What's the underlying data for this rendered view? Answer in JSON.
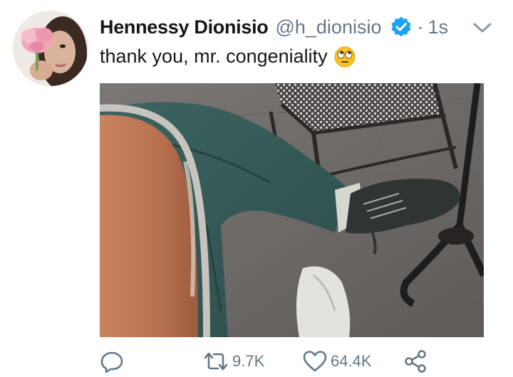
{
  "tweet": {
    "display_name": "Hennessy Dionisio",
    "handle": "@h_dionisio",
    "separator": "·",
    "timestamp": "1s",
    "text": "thank you, mr. congeniality"
  },
  "actions": {
    "retweet_count": "9.7K",
    "like_count": "64.4K"
  },
  "icons": {
    "verified": "verified-badge-icon",
    "more": "chevron-down-icon",
    "emoji": "face-with-rolling-eyes-emoji",
    "reply": "reply-icon",
    "retweet": "retweet-icon",
    "like": "heart-icon",
    "share": "share-icon"
  },
  "colors": {
    "name": "#14171a",
    "secondary": "#657786",
    "verified": "#1da1f2"
  }
}
